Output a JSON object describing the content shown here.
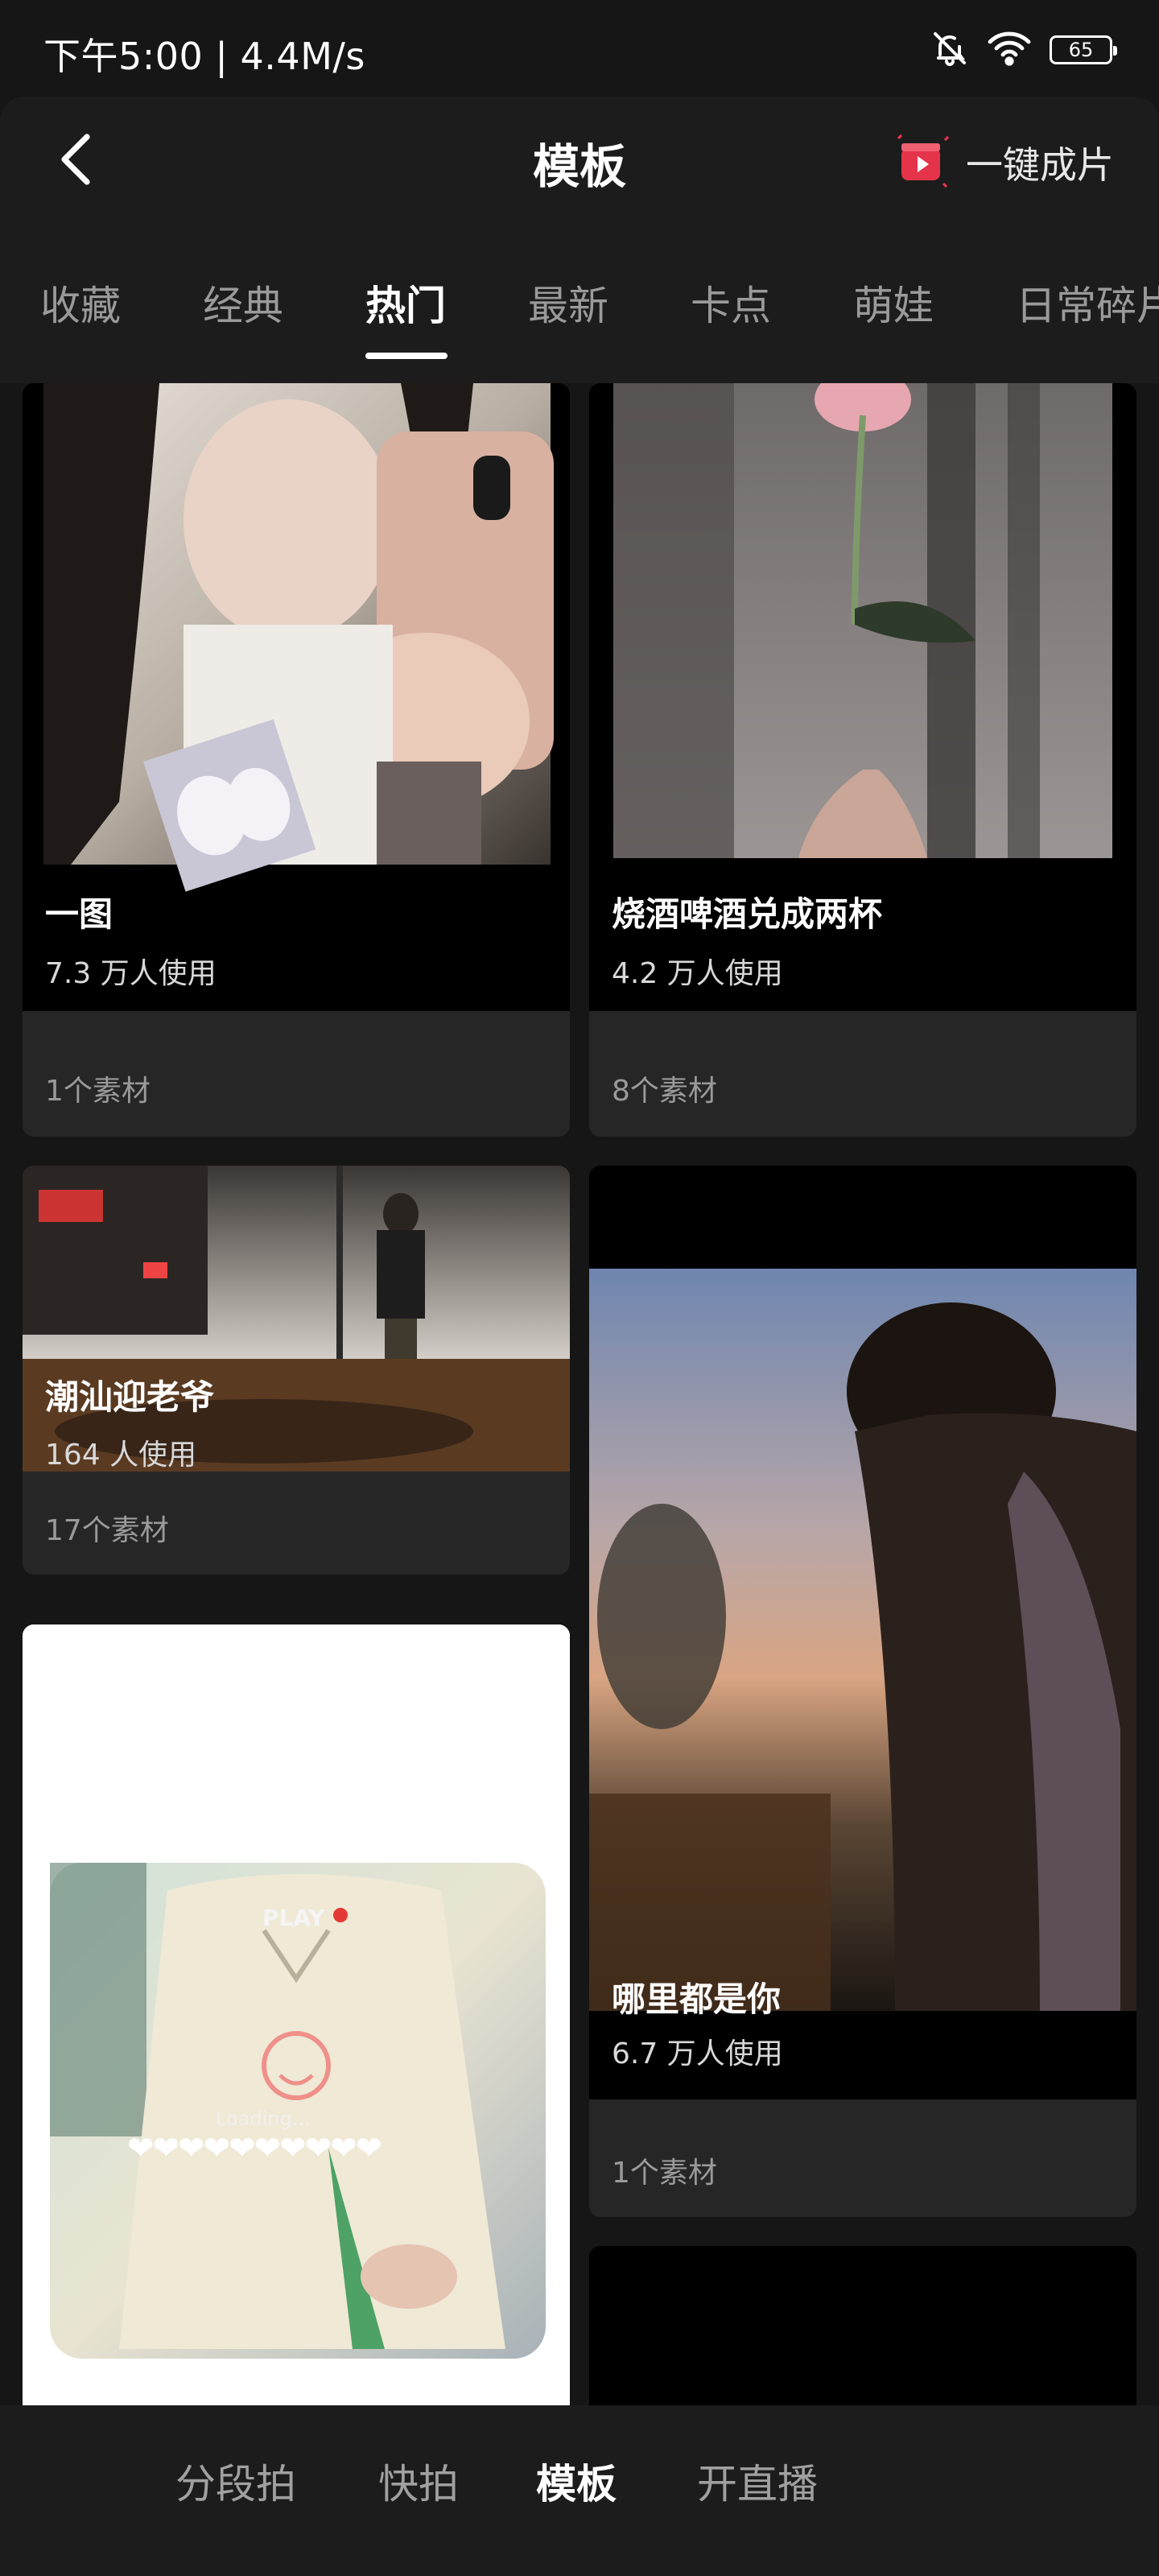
{
  "status_bar": {
    "time": "下午5:00 | 4.4M/s",
    "battery": "65",
    "icons": [
      "bell-off-icon",
      "wifi-icon",
      "battery-icon"
    ]
  },
  "header": {
    "title": "模板",
    "back_icon": "chevron-left-icon",
    "one_click_label": "一键成片",
    "one_click_icon": "clapperboard-play-icon",
    "accent_color": "#e5344a"
  },
  "tabs": [
    {
      "label": "收藏"
    },
    {
      "label": "经典"
    },
    {
      "label": "热门",
      "active": true
    },
    {
      "label": "最新"
    },
    {
      "label": "卡点"
    },
    {
      "label": "萌娃"
    },
    {
      "label": "日常碎片"
    }
  ],
  "cards": [
    {
      "title": "一图",
      "usage": "7.3 万人使用",
      "materials": "1个素材"
    },
    {
      "title": "烧酒啤酒兑成两杯",
      "usage": "4.2 万人使用",
      "materials": "8个素材"
    },
    {
      "title": "潮汕迎老爷",
      "usage": "164 人使用",
      "materials": "17个素材"
    },
    {
      "title": "哪里都是你",
      "usage": "6.7 万人使用",
      "materials": "1个素材"
    },
    {
      "overlay_text_1": "PLAY",
      "overlay_text_2": "Loading...",
      "overlay_hearts": "❤❤❤❤❤❤❤❤❤❤"
    }
  ],
  "bottom_nav": [
    {
      "label": "分段拍"
    },
    {
      "label": "快拍"
    },
    {
      "label": "模板",
      "active": true
    },
    {
      "label": "开直播"
    }
  ]
}
